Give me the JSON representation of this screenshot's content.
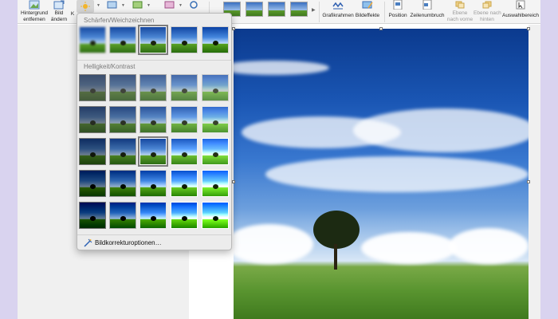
{
  "ribbon": {
    "remove_bg_line1": "Hintergrund",
    "remove_bg_line2": "entfernen",
    "change_image_line1": "Bild",
    "change_image_line2": "ändern",
    "frame": "Grafikrahmen",
    "effects": "Bildeffekte",
    "position": "Position",
    "wrap": "Zeilenumbruch",
    "bring_forward_line1": "Ebene",
    "bring_forward_line2": "nach vorne",
    "send_back_line1": "Ebene nach",
    "send_back_line2": "hinten",
    "selection": "Auswahlbereich",
    "partial_label": "K"
  },
  "dropdown": {
    "section1_title": "Schärfen/Weichzeichnen",
    "section2_title": "Helligkeit/Kontrast",
    "footer_label": "Bildkorrekturoptionen…"
  },
  "colors": {
    "accent_selection": "#7c7c7c",
    "page_background": "#d9d3ef"
  }
}
